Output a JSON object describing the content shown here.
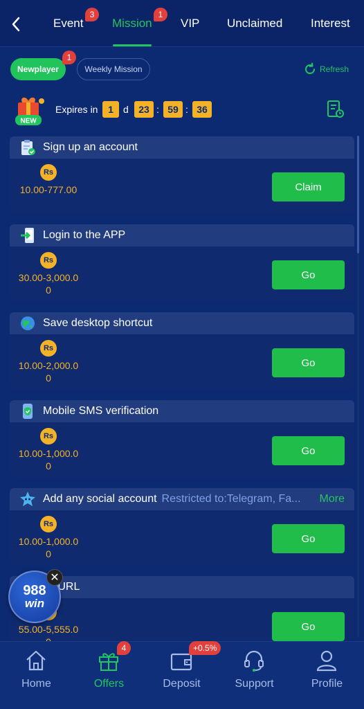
{
  "topnav": {
    "tabs": [
      {
        "label": "Event",
        "badge": "3"
      },
      {
        "label": "Mission",
        "badge": "1"
      },
      {
        "label": "VIP"
      },
      {
        "label": "Unclaimed"
      },
      {
        "label": "Interest"
      }
    ],
    "active_tab": "Mission"
  },
  "subtabs": {
    "newplayer": {
      "label": "Newplayer",
      "badge": "1"
    },
    "weekly": {
      "label": "Weekly Mission"
    },
    "refresh_label": "Refresh"
  },
  "expiry": {
    "gift_tag": "NEW",
    "label": "Expires in",
    "days": "1",
    "day_unit": "d",
    "hours": "23",
    "minutes": "59",
    "seconds": "36",
    "sep": ":"
  },
  "missions": [
    {
      "title": "Sign up an account",
      "currency": "Rs",
      "reward": "10.00-777.00",
      "action": "Claim",
      "icon": "clipboard-check-icon"
    },
    {
      "title": "Login to the APP",
      "currency": "Rs",
      "reward": "30.00-3,000.00",
      "action": "Go",
      "icon": "phone-login-icon"
    },
    {
      "title": "Save desktop shortcut",
      "currency": "Rs",
      "reward": "10.00-2,000.00",
      "action": "Go",
      "icon": "globe-icon"
    },
    {
      "title": "Mobile SMS verification",
      "currency": "Rs",
      "reward": "10.00-1,000.00",
      "action": "Go",
      "icon": "phone-shield-icon"
    },
    {
      "title": "Add any social account",
      "restricted": "Restricted to:Telegram, Fa...",
      "more": "More",
      "currency": "Rs",
      "reward": "10.00-1,000.00",
      "action": "Go",
      "icon": "social-star-icon"
    },
    {
      "title": "ve URL",
      "currency": "Rs",
      "reward": "55.00-5,555.00",
      "action": "Go",
      "icon": "link-icon"
    }
  ],
  "floating": {
    "line1": "988",
    "line2": "win",
    "close": "✕"
  },
  "bottomnav": {
    "items": [
      {
        "label": "Home"
      },
      {
        "label": "Offers",
        "badge": "4"
      },
      {
        "label": "Deposit",
        "badge": "+0.5%"
      },
      {
        "label": "Support"
      },
      {
        "label": "Profile"
      }
    ],
    "active": "Offers"
  },
  "colors": {
    "background": "#0c2a72",
    "accent": "#22c55e",
    "gold": "#f4b228",
    "badge": "#e2403d"
  }
}
